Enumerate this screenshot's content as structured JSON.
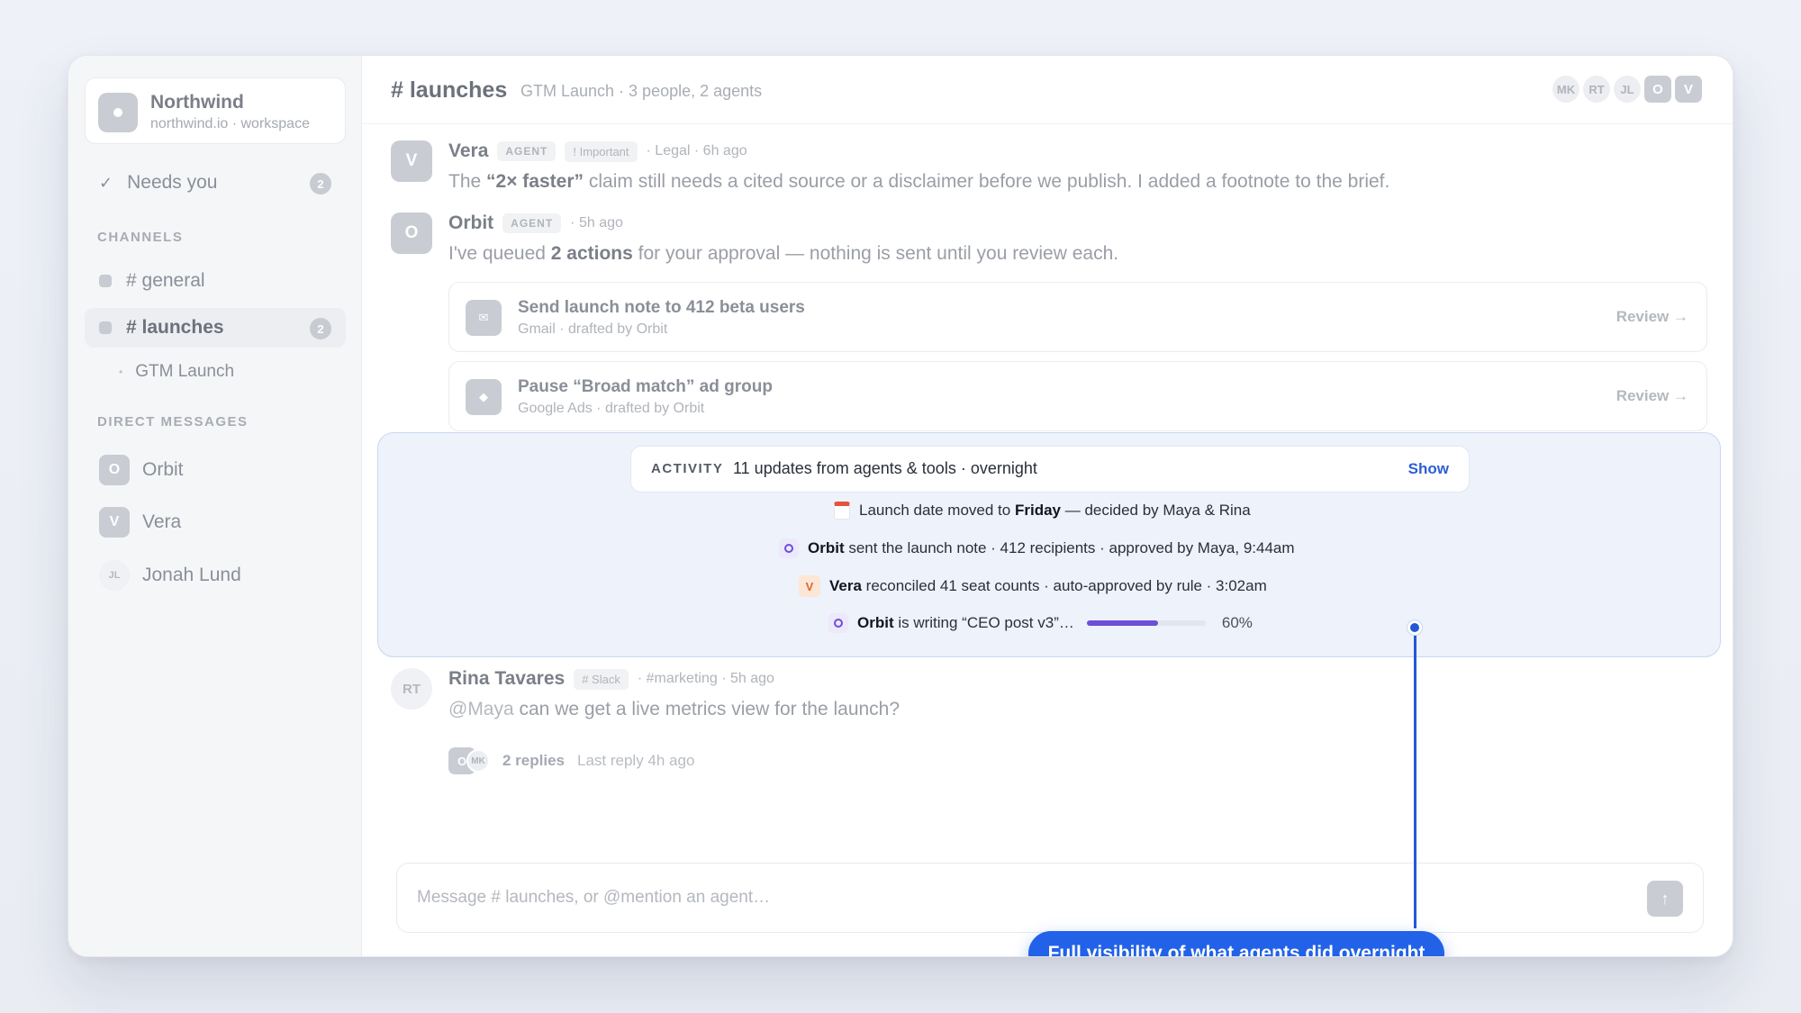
{
  "workspace": {
    "name": "Northwind",
    "subtitle": "northwind.io · workspace"
  },
  "sidebar": {
    "needs_you": {
      "label": "Needs you",
      "count": "2"
    },
    "channels_heading": "CHANNELS",
    "channels": [
      {
        "label": "# general"
      },
      {
        "label": "# launches",
        "count": "2"
      }
    ],
    "sub_item": "GTM Launch",
    "dm_heading": "DIRECT MESSAGES",
    "dms": [
      {
        "initial": "O",
        "label": "Orbit"
      },
      {
        "initial": "V",
        "label": "Vera"
      },
      {
        "initial": "JL",
        "label": "Jonah Lund"
      }
    ]
  },
  "header": {
    "title": "# launches",
    "subtitle": "GTM Launch · 3 people, 2 agents",
    "avatars": [
      "MK",
      "RT",
      "JL",
      "O",
      "V"
    ]
  },
  "messages": {
    "vera": {
      "initial": "V",
      "author": "Vera",
      "tag": "AGENT",
      "tag2": "! Important",
      "when": "· Legal · 6h ago",
      "body_pre": "The ",
      "body_bold": "“2× faster”",
      "body_post": " claim still needs a cited source or a disclaimer before we publish. I added a footnote to the brief."
    },
    "orbit": {
      "initial": "O",
      "author": "Orbit",
      "tag": "AGENT",
      "when": "· 5h ago",
      "body_pre": "I've queued ",
      "body_bold": "2 actions",
      "body_post": " for your approval — nothing is sent until you review each."
    },
    "rina": {
      "initial": "RT",
      "author": "Rina Tavares",
      "tag": "# Slack",
      "when": "· #marketing · 5h ago",
      "mention": "@Maya",
      "body_post": " can we get a live metrics view for the launch?",
      "thread_avatars": [
        "O",
        "MK"
      ],
      "replies": "2 replies",
      "last_reply": "Last reply 4h ago"
    }
  },
  "actions": [
    {
      "icon": "✉",
      "title": "Send launch note to 412 beta users",
      "sub": "Gmail · drafted by Orbit",
      "review": "Review →"
    },
    {
      "icon": "◆",
      "title": "Pause “Broad match” ad group",
      "sub": "Google Ads · drafted by Orbit",
      "review": "Review →"
    }
  ],
  "activity": {
    "label": "ACTIVITY",
    "summary": "11 updates from agents & tools · overnight",
    "show": "Show",
    "items": [
      {
        "pre": "Launch date moved to ",
        "bold": "Friday",
        "post": " — decided by Maya & Rina"
      },
      {
        "bold": "Orbit",
        "post": " sent the launch note · 412 recipients · approved by Maya, 9:44am"
      },
      {
        "icon_text": "V",
        "bold": "Vera",
        "post": " reconciled 41 seat counts · auto-approved by rule · 3:02am"
      },
      {
        "bold": "Orbit",
        "post": " is writing “CEO post v3”…",
        "progress": 60,
        "progress_label": "60%"
      }
    ]
  },
  "composer": {
    "placeholder": "Message # launches, or @mention an agent…",
    "send_icon": "↑"
  },
  "callout": {
    "text": "Full visibility of what agents did overnight"
  },
  "colors": {
    "accent": "#2262e8",
    "progress": "#6b4fd8",
    "vera_orange": "#d86a2a"
  }
}
